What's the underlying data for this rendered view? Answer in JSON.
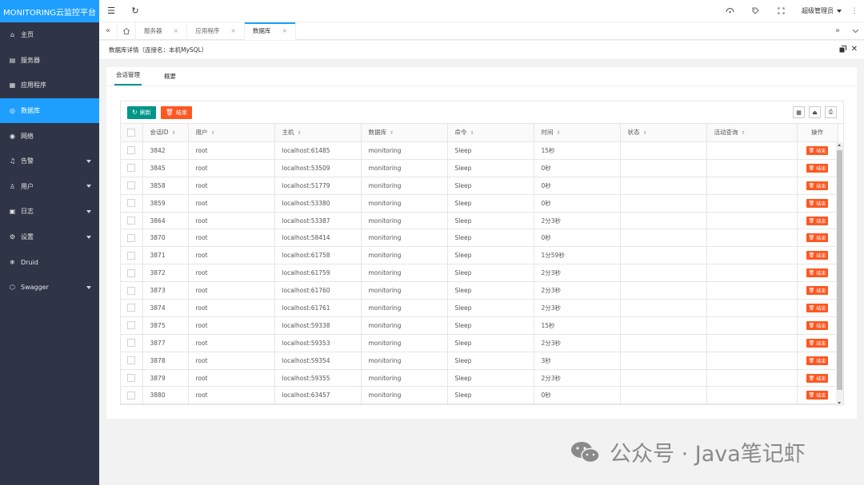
{
  "app": {
    "title": "MONITORING云监控平台"
  },
  "sidebar": {
    "items": [
      {
        "label": "主页",
        "icon": "home-icon",
        "glyph": "⌂",
        "caret": false,
        "active": false
      },
      {
        "label": "服务器",
        "icon": "server-icon",
        "glyph": "▤",
        "caret": false,
        "active": false
      },
      {
        "label": "应用程序",
        "icon": "app-icon",
        "glyph": "▦",
        "caret": false,
        "active": false
      },
      {
        "label": "数据库",
        "icon": "database-icon",
        "glyph": "◎",
        "caret": false,
        "active": true
      },
      {
        "label": "网络",
        "icon": "network-icon",
        "glyph": "◉",
        "caret": false,
        "active": false
      },
      {
        "label": "告警",
        "icon": "bell-icon",
        "glyph": "♫",
        "caret": true,
        "active": false
      },
      {
        "label": "用户",
        "icon": "user-icon",
        "glyph": "♙",
        "caret": true,
        "active": false
      },
      {
        "label": "日志",
        "icon": "log-icon",
        "glyph": "▣",
        "caret": true,
        "active": false
      },
      {
        "label": "设置",
        "icon": "gear-icon",
        "glyph": "⚙",
        "caret": true,
        "active": false
      },
      {
        "label": "Druid",
        "icon": "druid-icon",
        "glyph": "❄",
        "caret": false,
        "active": false
      },
      {
        "label": "Swagger",
        "icon": "swagger-icon",
        "glyph": "⬡",
        "caret": true,
        "active": false
      }
    ]
  },
  "header": {
    "menu_icon": "☰",
    "refresh_icon": "↻",
    "user_name": "超级管理员",
    "more_icon": "⋮"
  },
  "tabs": {
    "items": [
      {
        "label": "服务器",
        "active": false
      },
      {
        "label": "应用程序",
        "active": false
      },
      {
        "label": "数据库",
        "active": true
      }
    ],
    "close": "×"
  },
  "page": {
    "title": "数据库详情（连接名：本机MySQL）"
  },
  "subtabs": [
    "会话管理",
    "概要"
  ],
  "toolbar": {
    "refresh_label": "刷新",
    "kill_label": "结束"
  },
  "table": {
    "columns": [
      "会话ID",
      "用户",
      "主机",
      "数据库",
      "命令",
      "时间",
      "状态",
      "活动查询",
      "操作"
    ],
    "kill_label": "结束",
    "rows": [
      [
        "3842",
        "root",
        "localhost:61485",
        "monitoring",
        "Sleep",
        "15秒",
        "",
        ""
      ],
      [
        "3845",
        "root",
        "localhost:53509",
        "monitoring",
        "Sleep",
        "0秒",
        "",
        ""
      ],
      [
        "3858",
        "root",
        "localhost:51779",
        "monitoring",
        "Sleep",
        "0秒",
        "",
        ""
      ],
      [
        "3859",
        "root",
        "localhost:53380",
        "monitoring",
        "Sleep",
        "0秒",
        "",
        ""
      ],
      [
        "3864",
        "root",
        "localhost:53387",
        "monitoring",
        "Sleep",
        "2分3秒",
        "",
        ""
      ],
      [
        "3870",
        "root",
        "localhost:58414",
        "monitoring",
        "Sleep",
        "0秒",
        "",
        ""
      ],
      [
        "3871",
        "root",
        "localhost:61758",
        "monitoring",
        "Sleep",
        "1分59秒",
        "",
        ""
      ],
      [
        "3872",
        "root",
        "localhost:61759",
        "monitoring",
        "Sleep",
        "2分3秒",
        "",
        ""
      ],
      [
        "3873",
        "root",
        "localhost:61760",
        "monitoring",
        "Sleep",
        "2分3秒",
        "",
        ""
      ],
      [
        "3874",
        "root",
        "localhost:61761",
        "monitoring",
        "Sleep",
        "2分3秒",
        "",
        ""
      ],
      [
        "3875",
        "root",
        "localhost:59338",
        "monitoring",
        "Sleep",
        "15秒",
        "",
        ""
      ],
      [
        "3877",
        "root",
        "localhost:59353",
        "monitoring",
        "Sleep",
        "2分3秒",
        "",
        ""
      ],
      [
        "3878",
        "root",
        "localhost:59354",
        "monitoring",
        "Sleep",
        "3秒",
        "",
        ""
      ],
      [
        "3879",
        "root",
        "localhost:59355",
        "monitoring",
        "Sleep",
        "2分3秒",
        "",
        ""
      ],
      [
        "3880",
        "root",
        "localhost:63457",
        "monitoring",
        "Sleep",
        "0秒",
        "",
        ""
      ]
    ]
  },
  "watermark": {
    "text": "公众号 · Java笔记虾"
  },
  "colors": {
    "sidebar": "#2f3447",
    "accent": "#1e9fff",
    "green": "#009688",
    "orange": "#ff5722"
  }
}
